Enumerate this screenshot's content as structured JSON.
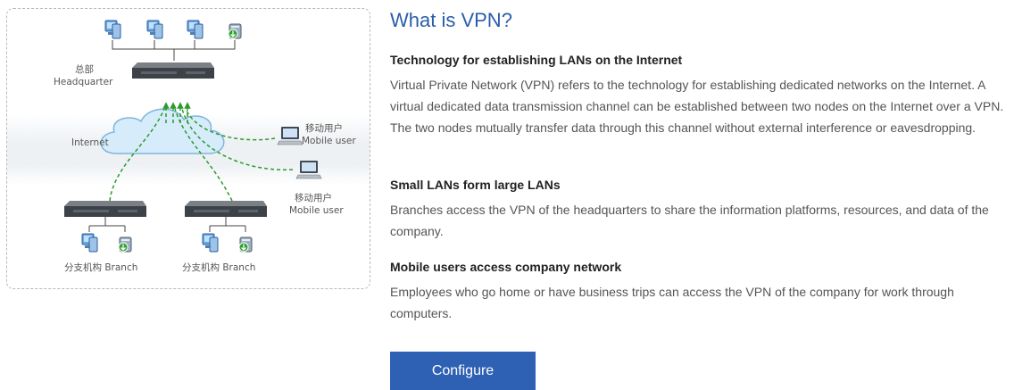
{
  "diagram": {
    "headquarter_cn": "总部",
    "headquarter_en": "Headquarter",
    "internet": "Internet",
    "mobile_user_1_cn": "移动用户",
    "mobile_user_1_en": "Mobile user",
    "mobile_user_2_cn": "移动用户",
    "mobile_user_2_en": "Mobile user",
    "branch_1": "分支机构 Branch",
    "branch_2": "分支机构 Branch"
  },
  "content": {
    "title": "What is VPN?",
    "sections": [
      {
        "heading": "Technology for establishing LANs on the Internet",
        "text": "Virtual Private Network (VPN) refers to the technology for establishing dedicated networks on the Internet. A virtual dedicated data transmission channel can be established between two nodes on the Internet over a VPN. The two nodes mutually transfer data through this channel without external interference or eavesdropping."
      },
      {
        "heading": "Small LANs form large LANs",
        "text": "Branches access the VPN of the headquarters to share the information platforms, resources, and data of the company."
      },
      {
        "heading": "Mobile users access company network",
        "text": "Employees who go home or have business trips can access the VPN of the company for work through computers."
      }
    ],
    "configure_label": "Configure"
  },
  "colors": {
    "title": "#2a5ea8",
    "button": "#2e61b4",
    "tunnel": "#2c9a2c",
    "cloud": "#cfe9f8"
  },
  "icons": [
    "pc-icon",
    "server-icon",
    "router-icon",
    "cloud-icon",
    "laptop-icon"
  ]
}
